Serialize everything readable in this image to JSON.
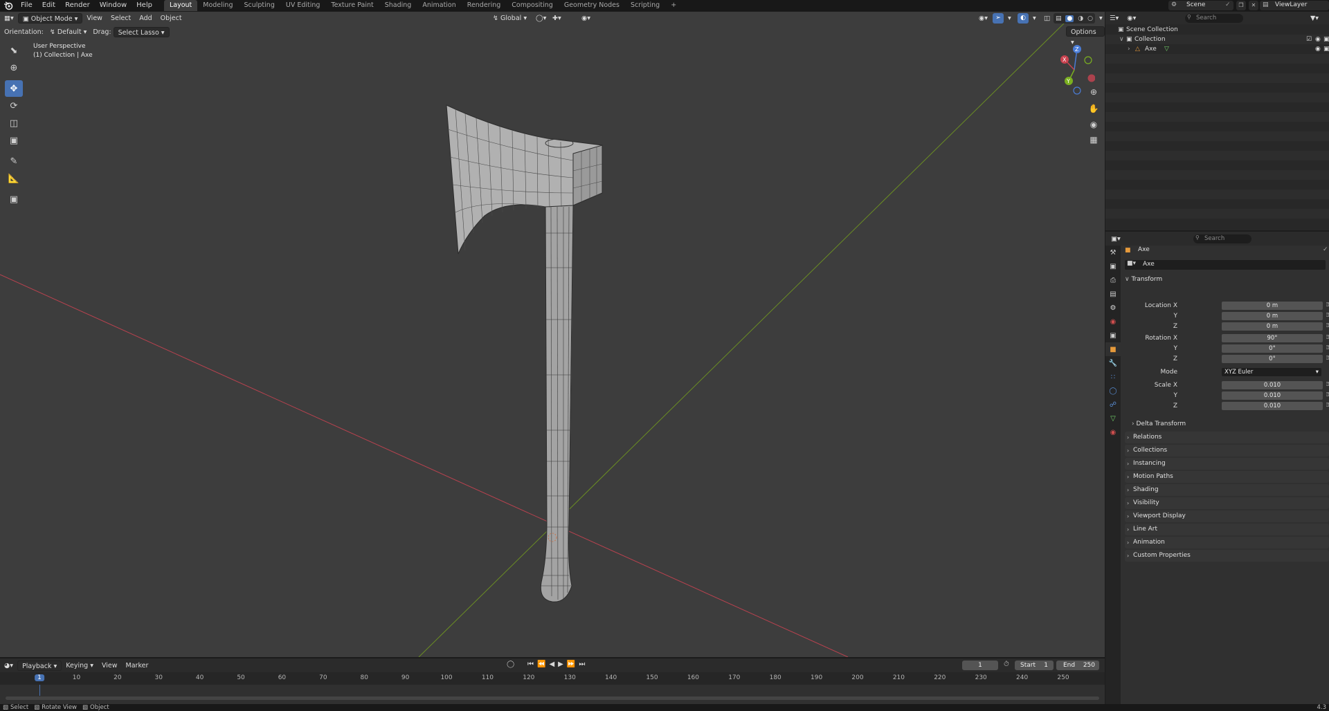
{
  "topbar": {
    "menus": [
      "File",
      "Edit",
      "Render",
      "Window",
      "Help"
    ],
    "workspaces": [
      "Layout",
      "Modeling",
      "Sculpting",
      "UV Editing",
      "Texture Paint",
      "Shading",
      "Animation",
      "Rendering",
      "Compositing",
      "Geometry Nodes",
      "Scripting"
    ],
    "active_workspace": "Layout",
    "add_tab": "+",
    "scene": "Scene",
    "view_layer": "ViewLayer"
  },
  "viewport": {
    "mode": "Object Mode",
    "menus": [
      "View",
      "Select",
      "Add",
      "Object"
    ],
    "orientation_label": "Orientation:",
    "orientation_value": "Default",
    "drag_label": "Drag:",
    "drag_value": "Select Lasso",
    "transform_orientation": "Global",
    "options": "Options",
    "overlay_line1": "User Perspective",
    "overlay_line2": "(1) Collection | Axe",
    "gizmo": {
      "z": "Z",
      "x": "X",
      "y": "Y"
    }
  },
  "timeline": {
    "menus": [
      "Playback",
      "Keying",
      "View",
      "Marker"
    ],
    "current_frame": "1",
    "start_label": "Start",
    "start": "1",
    "end_label": "End",
    "end": "250",
    "ticks": [
      "1",
      "10",
      "20",
      "30",
      "40",
      "50",
      "60",
      "70",
      "80",
      "90",
      "100",
      "110",
      "120",
      "130",
      "140",
      "150",
      "160",
      "170",
      "180",
      "190",
      "200",
      "210",
      "220",
      "230",
      "240",
      "250"
    ]
  },
  "statusbar": {
    "items": [
      "Select",
      "Rotate View",
      "Object"
    ],
    "version": "4.3"
  },
  "outliner": {
    "search_placeholder": "Search",
    "scene_collection": "Scene Collection",
    "collection": "Collection",
    "object": "Axe"
  },
  "properties": {
    "search_placeholder": "Search",
    "object_name": "Axe",
    "datablock_name": "Axe",
    "transform_label": "Transform",
    "location": {
      "label": "Location X",
      "x": "0 m",
      "y": "0 m",
      "z": "0 m"
    },
    "rotation": {
      "label": "Rotation X",
      "x": "90°",
      "y": "0°",
      "z": "0°"
    },
    "mode_label": "Mode",
    "mode_value": "XYZ Euler",
    "scale": {
      "label": "Scale X",
      "x": "0.010",
      "y": "0.010",
      "z": "0.010"
    },
    "axis_y": "Y",
    "axis_z": "Z",
    "delta_transform": "Delta Transform",
    "panels": [
      "Relations",
      "Collections",
      "Instancing",
      "Motion Paths",
      "Shading",
      "Visibility",
      "Viewport Display",
      "Line Art",
      "Animation",
      "Custom Properties"
    ]
  },
  "colors": {
    "accent": "#4772b3",
    "x_axis": "#b8424f",
    "y_axis": "#6b8e23",
    "viewport_bg": "#3d3d3d"
  }
}
